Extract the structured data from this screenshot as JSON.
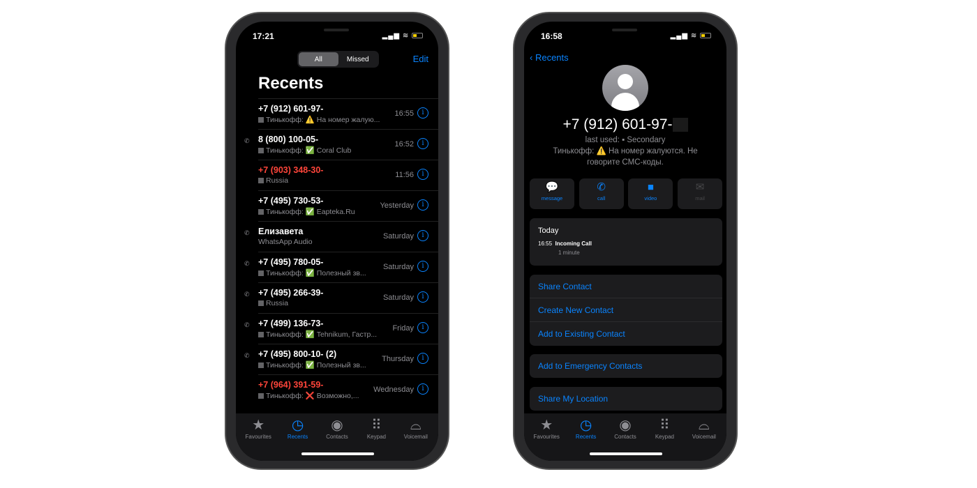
{
  "left": {
    "time": "17:21",
    "segments": [
      "All",
      "Missed"
    ],
    "edit": "Edit",
    "title": "Recents",
    "rows": [
      {
        "number": "+7 (912) 601-97-",
        "sub": "Тинькофф: ⚠️ На номер жалую...",
        "date": "16:55",
        "missed": false,
        "phone_icon": false
      },
      {
        "number": "8 (800) 100-05-",
        "sub": "Тинькофф: ✅ Coral Club",
        "date": "16:52",
        "missed": false,
        "phone_icon": true
      },
      {
        "number": "+7 (903) 348-30-",
        "sub": "Russia",
        "date": "11:56",
        "missed": true,
        "phone_icon": false
      },
      {
        "number": "+7 (495) 730-53-",
        "sub": "Тинькофф: ✅ Eapteka.Ru",
        "date": "Yesterday",
        "missed": false,
        "phone_icon": false
      },
      {
        "number": "Елизавета",
        "sub": "WhatsApp Audio",
        "date": "Saturday",
        "missed": false,
        "phone_icon": true,
        "plain": true
      },
      {
        "number": "+7 (495) 780-05-",
        "sub": "Тинькофф: ✅ Полезный зв...",
        "date": "Saturday",
        "missed": false,
        "phone_icon": true
      },
      {
        "number": "+7 (495) 266-39-",
        "sub": "Russia",
        "date": "Saturday",
        "missed": false,
        "phone_icon": true
      },
      {
        "number": "+7 (499) 136-73-",
        "sub": "Тинькофф: ✅ Tehnikum, Гастр...",
        "date": "Friday",
        "missed": false,
        "phone_icon": true
      },
      {
        "number": "+7 (495) 800-10-    (2)",
        "sub": "Тинькофф: ✅ Полезный зв...",
        "date": "Thursday",
        "missed": false,
        "phone_icon": true
      },
      {
        "number": "+7 (964) 391-59-",
        "sub": "Тинькофф: ❌ Возможно,...",
        "date": "Wednesday",
        "missed": true,
        "phone_icon": false
      }
    ]
  },
  "tabs": [
    {
      "label": "Favourites",
      "icon": "star-icon",
      "glyph": "★"
    },
    {
      "label": "Recents",
      "icon": "clock-icon",
      "glyph": "◷"
    },
    {
      "label": "Contacts",
      "icon": "person-circle-icon",
      "glyph": "◉"
    },
    {
      "label": "Keypad",
      "icon": "keypad-icon",
      "glyph": "⠿"
    },
    {
      "label": "Voicemail",
      "icon": "voicemail-icon",
      "glyph": "⌓"
    }
  ],
  "right": {
    "time": "16:58",
    "back": "Recents",
    "number": "+7 (912) 601-97-",
    "last_used": "last used: ▪ Secondary",
    "note": "Тинькофф: ⚠️ На номер жалуются. Не говорите СМС-коды.",
    "actions": [
      {
        "label": "message",
        "glyph": "💬",
        "icon": "message-icon"
      },
      {
        "label": "call",
        "glyph": "✆",
        "icon": "phone-icon"
      },
      {
        "label": "video",
        "glyph": "■",
        "icon": "video-icon"
      },
      {
        "label": "mail",
        "glyph": "✉",
        "icon": "mail-icon",
        "disabled": true
      }
    ],
    "history": {
      "day": "Today",
      "time": "16:55",
      "type": "Incoming Call",
      "duration": "1 minute"
    },
    "menu": [
      "Share Contact",
      "Create New Contact",
      "Add to Existing Contact"
    ],
    "emergency": "Add to Emergency Contacts",
    "share_location": "Share My Location"
  },
  "colors": {
    "accent": "#0a84ff",
    "missed": "#ff453a"
  }
}
